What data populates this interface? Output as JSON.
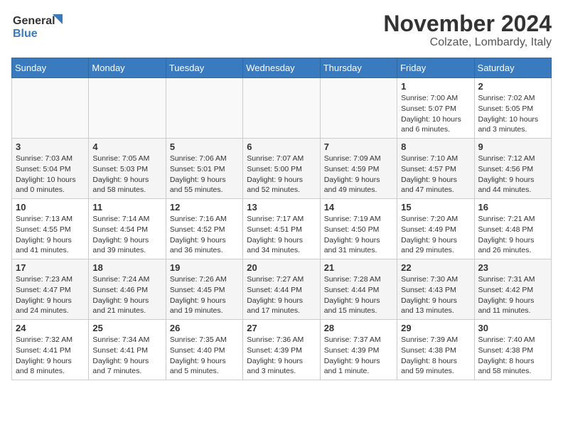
{
  "logo": {
    "line1": "General",
    "line2": "Blue"
  },
  "title": "November 2024",
  "location": "Colzate, Lombardy, Italy",
  "days_header": [
    "Sunday",
    "Monday",
    "Tuesday",
    "Wednesday",
    "Thursday",
    "Friday",
    "Saturday"
  ],
  "weeks": [
    [
      {
        "day": "",
        "info": ""
      },
      {
        "day": "",
        "info": ""
      },
      {
        "day": "",
        "info": ""
      },
      {
        "day": "",
        "info": ""
      },
      {
        "day": "",
        "info": ""
      },
      {
        "day": "1",
        "info": "Sunrise: 7:00 AM\nSunset: 5:07 PM\nDaylight: 10 hours\nand 6 minutes."
      },
      {
        "day": "2",
        "info": "Sunrise: 7:02 AM\nSunset: 5:05 PM\nDaylight: 10 hours\nand 3 minutes."
      }
    ],
    [
      {
        "day": "3",
        "info": "Sunrise: 7:03 AM\nSunset: 5:04 PM\nDaylight: 10 hours\nand 0 minutes."
      },
      {
        "day": "4",
        "info": "Sunrise: 7:05 AM\nSunset: 5:03 PM\nDaylight: 9 hours\nand 58 minutes."
      },
      {
        "day": "5",
        "info": "Sunrise: 7:06 AM\nSunset: 5:01 PM\nDaylight: 9 hours\nand 55 minutes."
      },
      {
        "day": "6",
        "info": "Sunrise: 7:07 AM\nSunset: 5:00 PM\nDaylight: 9 hours\nand 52 minutes."
      },
      {
        "day": "7",
        "info": "Sunrise: 7:09 AM\nSunset: 4:59 PM\nDaylight: 9 hours\nand 49 minutes."
      },
      {
        "day": "8",
        "info": "Sunrise: 7:10 AM\nSunset: 4:57 PM\nDaylight: 9 hours\nand 47 minutes."
      },
      {
        "day": "9",
        "info": "Sunrise: 7:12 AM\nSunset: 4:56 PM\nDaylight: 9 hours\nand 44 minutes."
      }
    ],
    [
      {
        "day": "10",
        "info": "Sunrise: 7:13 AM\nSunset: 4:55 PM\nDaylight: 9 hours\nand 41 minutes."
      },
      {
        "day": "11",
        "info": "Sunrise: 7:14 AM\nSunset: 4:54 PM\nDaylight: 9 hours\nand 39 minutes."
      },
      {
        "day": "12",
        "info": "Sunrise: 7:16 AM\nSunset: 4:52 PM\nDaylight: 9 hours\nand 36 minutes."
      },
      {
        "day": "13",
        "info": "Sunrise: 7:17 AM\nSunset: 4:51 PM\nDaylight: 9 hours\nand 34 minutes."
      },
      {
        "day": "14",
        "info": "Sunrise: 7:19 AM\nSunset: 4:50 PM\nDaylight: 9 hours\nand 31 minutes."
      },
      {
        "day": "15",
        "info": "Sunrise: 7:20 AM\nSunset: 4:49 PM\nDaylight: 9 hours\nand 29 minutes."
      },
      {
        "day": "16",
        "info": "Sunrise: 7:21 AM\nSunset: 4:48 PM\nDaylight: 9 hours\nand 26 minutes."
      }
    ],
    [
      {
        "day": "17",
        "info": "Sunrise: 7:23 AM\nSunset: 4:47 PM\nDaylight: 9 hours\nand 24 minutes."
      },
      {
        "day": "18",
        "info": "Sunrise: 7:24 AM\nSunset: 4:46 PM\nDaylight: 9 hours\nand 21 minutes."
      },
      {
        "day": "19",
        "info": "Sunrise: 7:26 AM\nSunset: 4:45 PM\nDaylight: 9 hours\nand 19 minutes."
      },
      {
        "day": "20",
        "info": "Sunrise: 7:27 AM\nSunset: 4:44 PM\nDaylight: 9 hours\nand 17 minutes."
      },
      {
        "day": "21",
        "info": "Sunrise: 7:28 AM\nSunset: 4:44 PM\nDaylight: 9 hours\nand 15 minutes."
      },
      {
        "day": "22",
        "info": "Sunrise: 7:30 AM\nSunset: 4:43 PM\nDaylight: 9 hours\nand 13 minutes."
      },
      {
        "day": "23",
        "info": "Sunrise: 7:31 AM\nSunset: 4:42 PM\nDaylight: 9 hours\nand 11 minutes."
      }
    ],
    [
      {
        "day": "24",
        "info": "Sunrise: 7:32 AM\nSunset: 4:41 PM\nDaylight: 9 hours\nand 8 minutes."
      },
      {
        "day": "25",
        "info": "Sunrise: 7:34 AM\nSunset: 4:41 PM\nDaylight: 9 hours\nand 7 minutes."
      },
      {
        "day": "26",
        "info": "Sunrise: 7:35 AM\nSunset: 4:40 PM\nDaylight: 9 hours\nand 5 minutes."
      },
      {
        "day": "27",
        "info": "Sunrise: 7:36 AM\nSunset: 4:39 PM\nDaylight: 9 hours\nand 3 minutes."
      },
      {
        "day": "28",
        "info": "Sunrise: 7:37 AM\nSunset: 4:39 PM\nDaylight: 9 hours\nand 1 minute."
      },
      {
        "day": "29",
        "info": "Sunrise: 7:39 AM\nSunset: 4:38 PM\nDaylight: 8 hours\nand 59 minutes."
      },
      {
        "day": "30",
        "info": "Sunrise: 7:40 AM\nSunset: 4:38 PM\nDaylight: 8 hours\nand 58 minutes."
      }
    ]
  ]
}
